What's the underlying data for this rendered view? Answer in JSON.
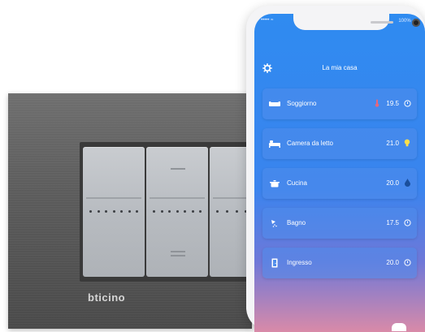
{
  "wall_switch": {
    "brand": "bticino"
  },
  "phone": {
    "status_left": "••••• ≈",
    "status_right": "100% ▭",
    "home": {
      "title": "La mia casa",
      "settings_icon": "gear-icon"
    },
    "rooms": [
      {
        "name": "Soggiorno",
        "temperature": "19.5",
        "icon": "sofa-icon",
        "status_icon": "thermometer-icon",
        "status_color": "#e8667a"
      },
      {
        "name": "Camera da letto",
        "temperature": "21.0",
        "icon": "bed-icon",
        "status_icon": "bulb-icon",
        "status_color": "#ffe04a"
      },
      {
        "name": "Cucina",
        "temperature": "20.0",
        "icon": "pot-icon",
        "status_icon": "drop-icon",
        "status_color": "#1a4f9c"
      },
      {
        "name": "Bagno",
        "temperature": "17.5",
        "icon": "shower-icon",
        "status_icon": "standby-icon",
        "status_color": "#ffffff"
      },
      {
        "name": "Ingresso",
        "temperature": "20.0",
        "icon": "door-icon",
        "status_icon": "standby-icon",
        "status_color": "#ffffff"
      }
    ]
  },
  "colors": {
    "screen_top": "#2f8bf0",
    "card": "#4f8ceb"
  }
}
